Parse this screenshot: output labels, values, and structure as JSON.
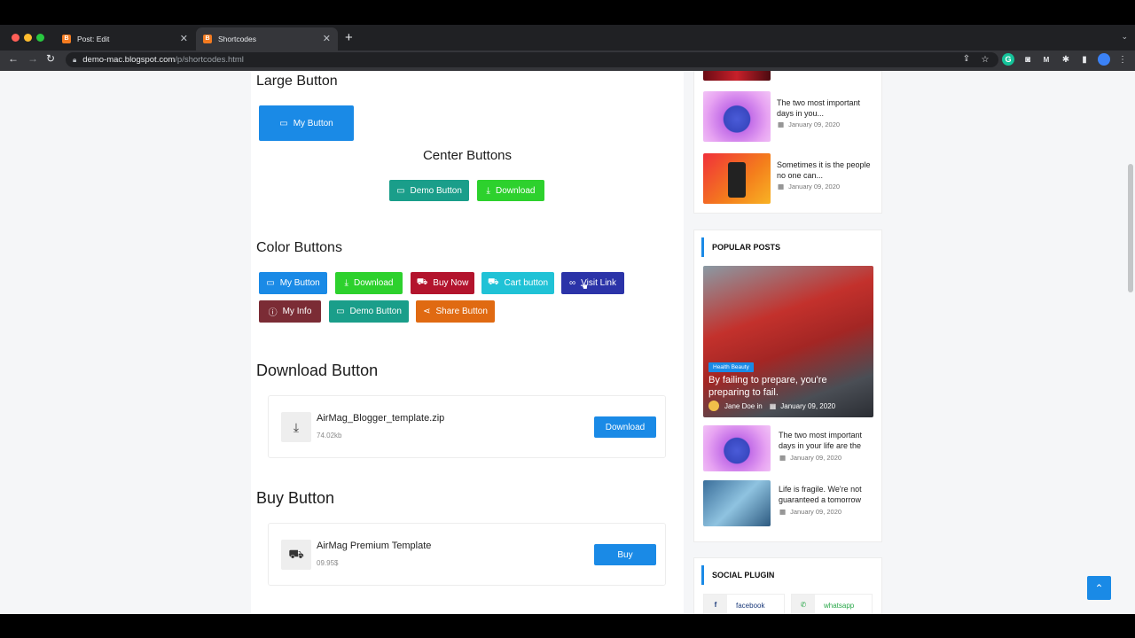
{
  "browser": {
    "tabs": [
      {
        "label": "Post: Edit",
        "favicon": "B"
      },
      {
        "label": "Shortcodes",
        "favicon": "B"
      }
    ],
    "new_tab_icon": "plus-icon",
    "url_host": "demo-mac.blogspot.com",
    "url_path": "/p/shortcodes.html"
  },
  "main": {
    "large_button": {
      "heading": "Large Button",
      "label": "My Button"
    },
    "center_buttons": {
      "heading": "Center Buttons",
      "demo_label": "Demo Button",
      "download_label": "Download"
    },
    "color_buttons": {
      "heading": "Color Buttons",
      "buttons": [
        {
          "label": "My Button",
          "color": "#1a8ae6",
          "icon": "folder-icon"
        },
        {
          "label": "Download",
          "color": "#2dd12d",
          "icon": "download-icon"
        },
        {
          "label": "Buy Now",
          "color": "#b3142d",
          "icon": "cart-icon"
        },
        {
          "label": "Cart button",
          "color": "#20c2d6",
          "icon": "cart-add-icon"
        },
        {
          "label": "Visit Link",
          "color": "#2b33a8",
          "icon": "link-icon"
        },
        {
          "label": "My Info",
          "color": "#7b2c35",
          "icon": "info-icon"
        },
        {
          "label": "Demo Button",
          "color": "#1a9e8a",
          "icon": "folder-icon"
        },
        {
          "label": "Share Button",
          "color": "#e06a12",
          "icon": "share-icon"
        }
      ]
    },
    "download_section": {
      "heading": "Download Button",
      "file_name": "AirMag_Blogger_template.zip",
      "file_size": "74.02kb",
      "action": "Download"
    },
    "buy_section": {
      "heading": "Buy Button",
      "product_name": "AirMag Premium Template",
      "price": "09.95$",
      "action": "Buy"
    }
  },
  "sidebar": {
    "recent_posts": [
      {
        "title": "The two most important days in you...",
        "date": "January 09, 2020"
      },
      {
        "title": "Sometimes it is the people no one can...",
        "date": "January 09, 2020"
      }
    ],
    "popular_posts": {
      "title": "POPULAR POSTS",
      "featured": {
        "category": "Health Beauty",
        "title": "By failing to prepare, you're preparing to fail.",
        "author": "Jane Doe in",
        "date": "January 09, 2020"
      },
      "items": [
        {
          "title": "The two most important days in your life are the",
          "date": "January 09, 2020"
        },
        {
          "title": "Life is fragile. We're not guaranteed a tomorrow",
          "date": "January 09, 2020"
        }
      ]
    },
    "social_plugin": {
      "title": "SOCIAL PLUGIN",
      "items": [
        {
          "label": "facebook",
          "icon": "facebook-icon"
        },
        {
          "label": "whatsapp",
          "icon": "whatsapp-icon"
        }
      ]
    }
  },
  "colors": {
    "accent": "#1a8ae6",
    "teal": "#1a9e8a",
    "green": "#2dd12d"
  }
}
